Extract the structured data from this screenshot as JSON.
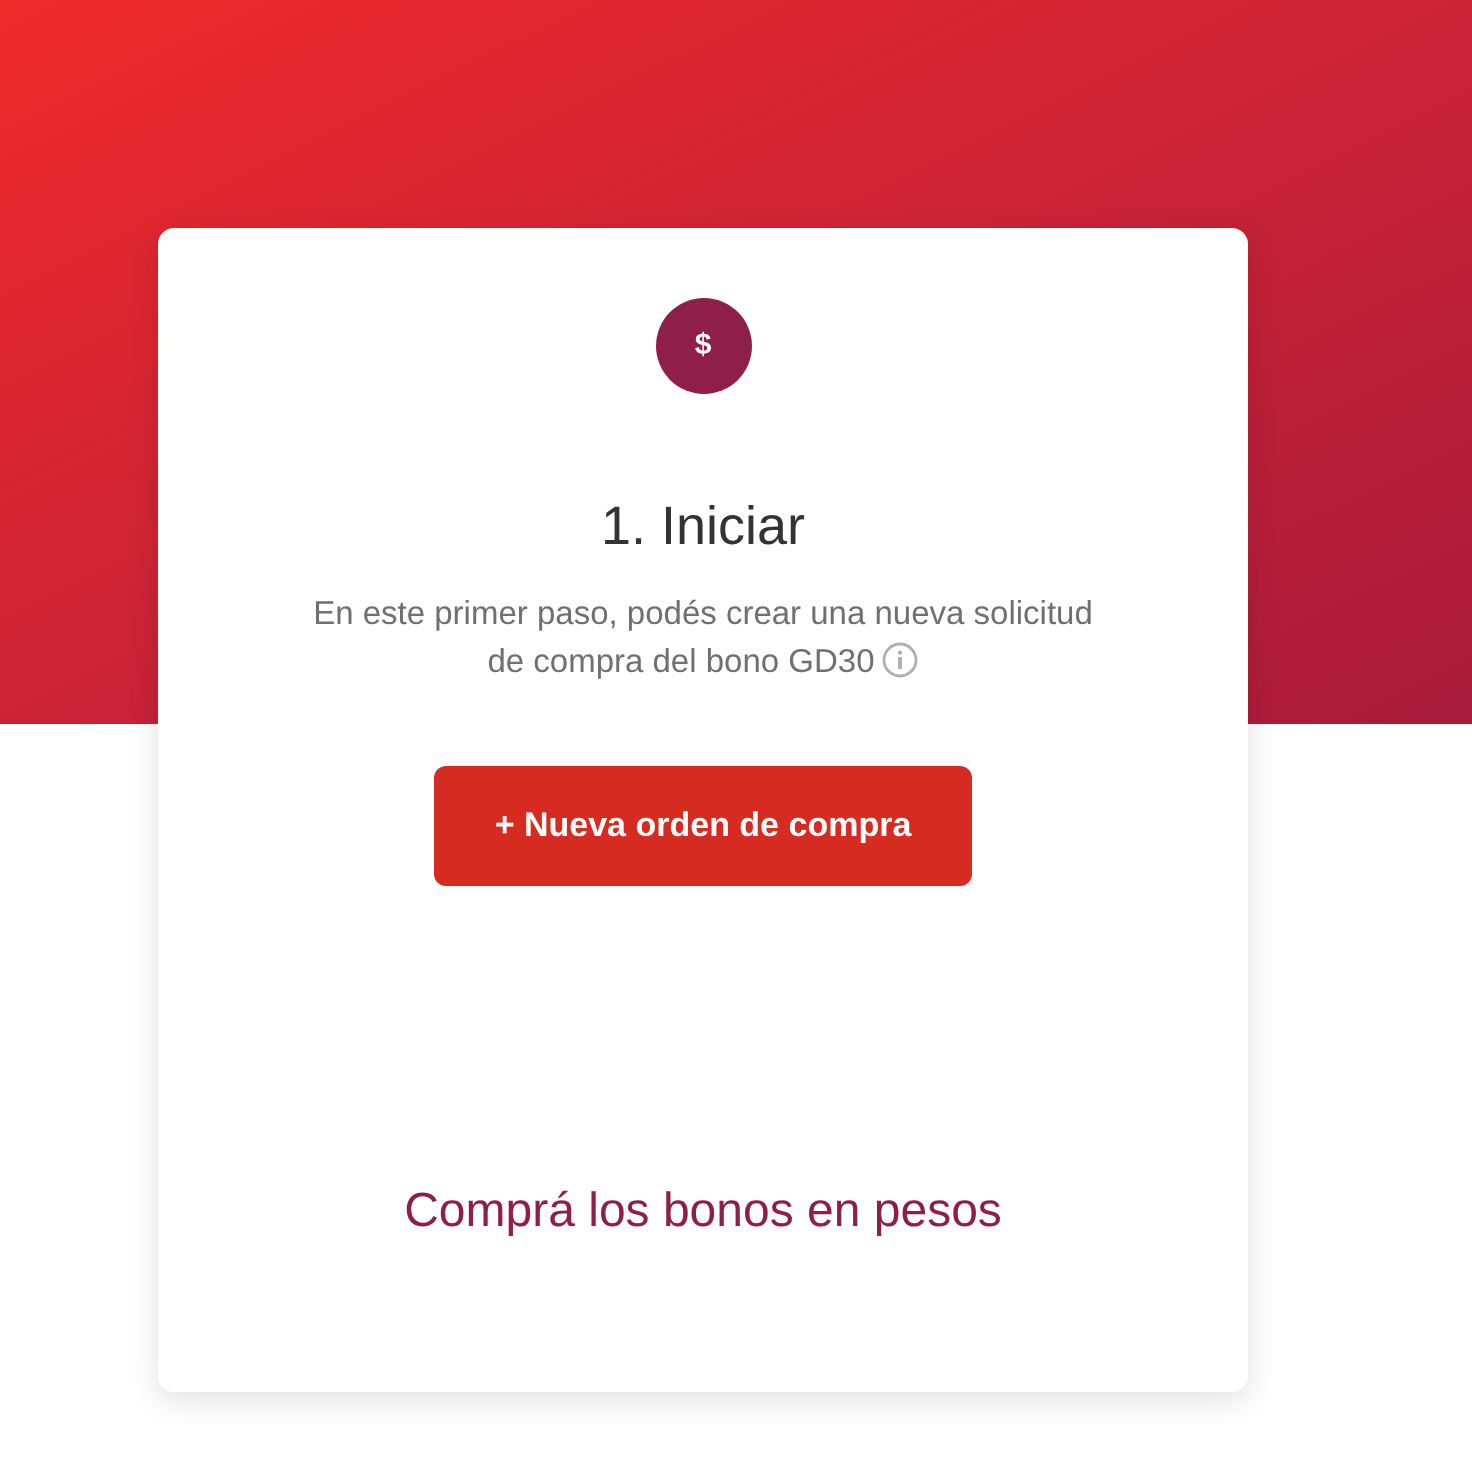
{
  "card": {
    "icon_symbol": "$",
    "title": "1. Iniciar",
    "description": "En este primer paso, podés crear una nueva solicitud de compra del bono GD30",
    "primary_button": "+ Nueva orden de compra",
    "link": "Comprá los bonos en pesos"
  }
}
